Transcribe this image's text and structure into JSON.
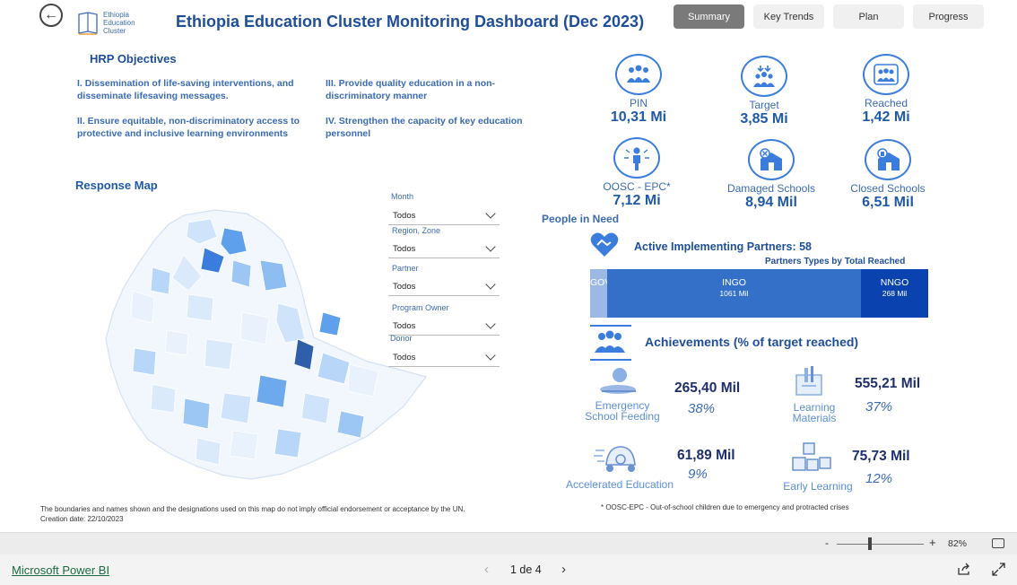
{
  "header": {
    "title": "Ethiopia Education Cluster Monitoring Dashboard (Dec 2023)",
    "logo_text": [
      "Ethiopia",
      "Education",
      "Cluster"
    ],
    "tabs": [
      {
        "label": "Summary",
        "active": true
      },
      {
        "label": "Key Trends",
        "active": false
      },
      {
        "label": "Plan",
        "active": false
      },
      {
        "label": "Progress",
        "active": false
      }
    ]
  },
  "objectives": {
    "title": "HRP Objectives",
    "items": [
      "I. Dissemination of life-saving interventions, and disseminate lifesaving messages.",
      "II. Ensure equitable, non-discriminatory access to protective and inclusive learning environments",
      "III. Provide quality education in a non-discriminatory manner",
      "IV. Strengthen the capacity of key education personnel"
    ]
  },
  "map": {
    "title": "Response Map",
    "disclaimer": "The boundaries and names shown and the designations used on this map do not imply official endorsement or acceptance by the UN.",
    "creation_date": "Creation date: 22/10/2023"
  },
  "filters": [
    {
      "label": "Month",
      "value": "Todos"
    },
    {
      "label": "Region, Zone",
      "value": "Todos"
    },
    {
      "label": "Partner",
      "value": "Todos"
    },
    {
      "label": "Program Owner",
      "value": "Todos"
    },
    {
      "label": "Donor",
      "value": "Todos"
    }
  ],
  "kpis": [
    {
      "label": "PIN",
      "value": "10,31 Mi",
      "icon": "people-group-icon"
    },
    {
      "label": "Target",
      "value": "3,85 Mi",
      "icon": "target-people-icon"
    },
    {
      "label": "Reached",
      "value": "1,42 Mi",
      "icon": "reached-people-icon"
    },
    {
      "label": "OOSC - EPC*",
      "value": "7,12 Mi",
      "icon": "child-icon"
    },
    {
      "label": "Damaged Schools",
      "value": "8,94 Mil",
      "icon": "damaged-school-icon"
    },
    {
      "label": "Closed Schools",
      "value": "6,51 Mil",
      "icon": "closed-school-icon"
    }
  ],
  "pin_caption": "People in Need",
  "partners": {
    "title": "Active Implementing Partners: 58",
    "subtitle": "Partners Types by Total Reached",
    "segments": [
      {
        "name": "GOV",
        "value": "",
        "color": "#9cb9e6"
      },
      {
        "name": "INGO",
        "value": "1061 Mil",
        "color": "#3470c8"
      },
      {
        "name": "NNGO",
        "value": "268 Mil",
        "color": "#0a43b0"
      }
    ],
    "shares": [
      0.05,
      0.75,
      0.2
    ]
  },
  "achievements": {
    "title": "Achievements (% of target reached)",
    "items": [
      {
        "label": "Emergency School Feeding",
        "value": "265,40 Mil",
        "pct": "38%"
      },
      {
        "label": "Learning Materials",
        "value": "555,21 Mil",
        "pct": "37%"
      },
      {
        "label": "Accelerated Education",
        "value": "61,89 Mil",
        "pct": "9%"
      },
      {
        "label": "Early Learning",
        "value": "75,73 Mil",
        "pct": "12%"
      }
    ]
  },
  "footnote": "* OOSC-EPC - Out-of-school children due to emergency and protracted crises",
  "statusbar": {
    "zoom_minus": "-",
    "zoom_plus": "+",
    "zoom": "82%"
  },
  "footer": {
    "brand": "Microsoft Power BI",
    "page": "1 de 4"
  }
}
